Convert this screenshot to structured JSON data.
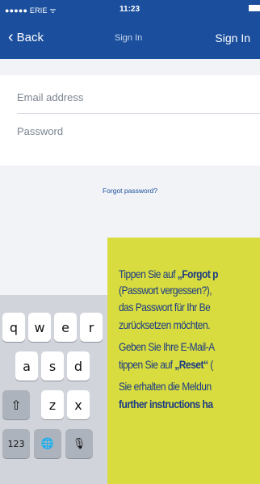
{
  "status": {
    "carrier": "●●●●● ERIE ᯤ",
    "time": "11:23"
  },
  "nav": {
    "back_label": "Back",
    "title": "Sign In",
    "action_label": "Sign In"
  },
  "form": {
    "email_placeholder": "Email address",
    "password_placeholder": "Password"
  },
  "forgot_link": "Forgot password?",
  "keyboard": {
    "row1": [
      "q",
      "w",
      "e",
      "r"
    ],
    "row2": [
      "a",
      "s",
      "d"
    ],
    "row3": [
      "⇧",
      "z",
      "x"
    ],
    "row4": [
      "123",
      "🌐",
      "🎙"
    ]
  },
  "tooltip": {
    "line1_pre": "Tippen Sie auf ",
    "line1_bold": "„Forgot p",
    "line2": "(Passwort vergessen?),",
    "line3": "das Passwort für Ihr Be",
    "line4": "zurücksetzen möchten.",
    "line5": "Geben Sie Ihre E-Mail-A",
    "line6_pre": "tippen Sie auf ",
    "line6_bold": "„Reset“",
    "line6_post": " (",
    "line7": "Sie erhalten die Meldun",
    "line8_bold": "further instructions ha"
  },
  "colors": {
    "brand": "#1b4f9d",
    "tooltip_bg": "#d8dc3e",
    "tooltip_text": "#1b3a86"
  }
}
